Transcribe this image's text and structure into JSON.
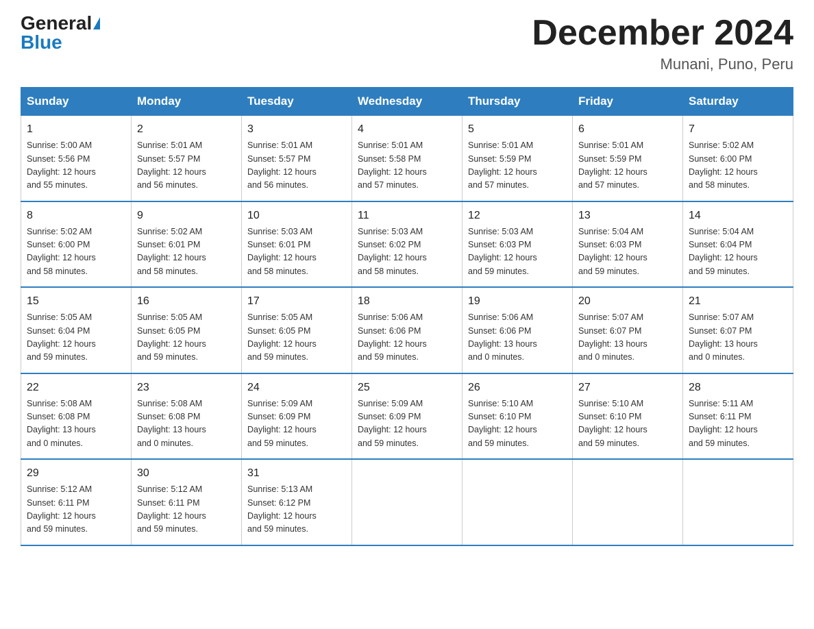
{
  "header": {
    "logo_general": "General",
    "logo_blue": "Blue",
    "month_title": "December 2024",
    "location": "Munani, Puno, Peru"
  },
  "days_of_week": [
    "Sunday",
    "Monday",
    "Tuesday",
    "Wednesday",
    "Thursday",
    "Friday",
    "Saturday"
  ],
  "weeks": [
    [
      {
        "day": "1",
        "sunrise": "5:00 AM",
        "sunset": "5:56 PM",
        "daylight": "12 hours and 55 minutes."
      },
      {
        "day": "2",
        "sunrise": "5:01 AM",
        "sunset": "5:57 PM",
        "daylight": "12 hours and 56 minutes."
      },
      {
        "day": "3",
        "sunrise": "5:01 AM",
        "sunset": "5:57 PM",
        "daylight": "12 hours and 56 minutes."
      },
      {
        "day": "4",
        "sunrise": "5:01 AM",
        "sunset": "5:58 PM",
        "daylight": "12 hours and 57 minutes."
      },
      {
        "day": "5",
        "sunrise": "5:01 AM",
        "sunset": "5:59 PM",
        "daylight": "12 hours and 57 minutes."
      },
      {
        "day": "6",
        "sunrise": "5:01 AM",
        "sunset": "5:59 PM",
        "daylight": "12 hours and 57 minutes."
      },
      {
        "day": "7",
        "sunrise": "5:02 AM",
        "sunset": "6:00 PM",
        "daylight": "12 hours and 58 minutes."
      }
    ],
    [
      {
        "day": "8",
        "sunrise": "5:02 AM",
        "sunset": "6:00 PM",
        "daylight": "12 hours and 58 minutes."
      },
      {
        "day": "9",
        "sunrise": "5:02 AM",
        "sunset": "6:01 PM",
        "daylight": "12 hours and 58 minutes."
      },
      {
        "day": "10",
        "sunrise": "5:03 AM",
        "sunset": "6:01 PM",
        "daylight": "12 hours and 58 minutes."
      },
      {
        "day": "11",
        "sunrise": "5:03 AM",
        "sunset": "6:02 PM",
        "daylight": "12 hours and 58 minutes."
      },
      {
        "day": "12",
        "sunrise": "5:03 AM",
        "sunset": "6:03 PM",
        "daylight": "12 hours and 59 minutes."
      },
      {
        "day": "13",
        "sunrise": "5:04 AM",
        "sunset": "6:03 PM",
        "daylight": "12 hours and 59 minutes."
      },
      {
        "day": "14",
        "sunrise": "5:04 AM",
        "sunset": "6:04 PM",
        "daylight": "12 hours and 59 minutes."
      }
    ],
    [
      {
        "day": "15",
        "sunrise": "5:05 AM",
        "sunset": "6:04 PM",
        "daylight": "12 hours and 59 minutes."
      },
      {
        "day": "16",
        "sunrise": "5:05 AM",
        "sunset": "6:05 PM",
        "daylight": "12 hours and 59 minutes."
      },
      {
        "day": "17",
        "sunrise": "5:05 AM",
        "sunset": "6:05 PM",
        "daylight": "12 hours and 59 minutes."
      },
      {
        "day": "18",
        "sunrise": "5:06 AM",
        "sunset": "6:06 PM",
        "daylight": "12 hours and 59 minutes."
      },
      {
        "day": "19",
        "sunrise": "5:06 AM",
        "sunset": "6:06 PM",
        "daylight": "13 hours and 0 minutes."
      },
      {
        "day": "20",
        "sunrise": "5:07 AM",
        "sunset": "6:07 PM",
        "daylight": "13 hours and 0 minutes."
      },
      {
        "day": "21",
        "sunrise": "5:07 AM",
        "sunset": "6:07 PM",
        "daylight": "13 hours and 0 minutes."
      }
    ],
    [
      {
        "day": "22",
        "sunrise": "5:08 AM",
        "sunset": "6:08 PM",
        "daylight": "13 hours and 0 minutes."
      },
      {
        "day": "23",
        "sunrise": "5:08 AM",
        "sunset": "6:08 PM",
        "daylight": "13 hours and 0 minutes."
      },
      {
        "day": "24",
        "sunrise": "5:09 AM",
        "sunset": "6:09 PM",
        "daylight": "12 hours and 59 minutes."
      },
      {
        "day": "25",
        "sunrise": "5:09 AM",
        "sunset": "6:09 PM",
        "daylight": "12 hours and 59 minutes."
      },
      {
        "day": "26",
        "sunrise": "5:10 AM",
        "sunset": "6:10 PM",
        "daylight": "12 hours and 59 minutes."
      },
      {
        "day": "27",
        "sunrise": "5:10 AM",
        "sunset": "6:10 PM",
        "daylight": "12 hours and 59 minutes."
      },
      {
        "day": "28",
        "sunrise": "5:11 AM",
        "sunset": "6:11 PM",
        "daylight": "12 hours and 59 minutes."
      }
    ],
    [
      {
        "day": "29",
        "sunrise": "5:12 AM",
        "sunset": "6:11 PM",
        "daylight": "12 hours and 59 minutes."
      },
      {
        "day": "30",
        "sunrise": "5:12 AM",
        "sunset": "6:11 PM",
        "daylight": "12 hours and 59 minutes."
      },
      {
        "day": "31",
        "sunrise": "5:13 AM",
        "sunset": "6:12 PM",
        "daylight": "12 hours and 59 minutes."
      },
      null,
      null,
      null,
      null
    ]
  ]
}
